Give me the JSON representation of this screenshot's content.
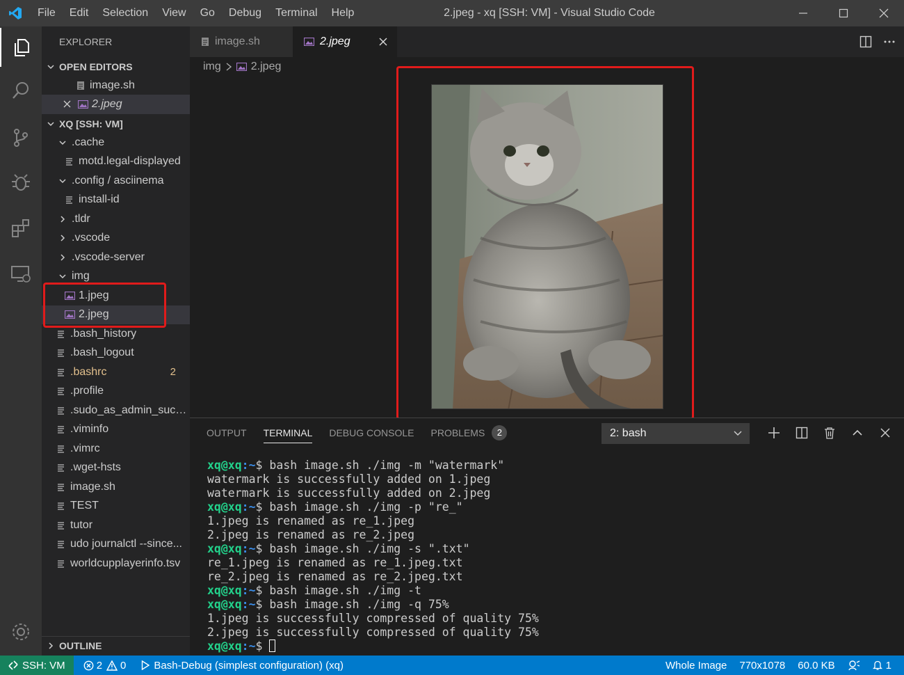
{
  "window": {
    "title": "2.jpeg - xq [SSH: VM] - Visual Studio Code",
    "menu": [
      "File",
      "Edit",
      "Selection",
      "View",
      "Go",
      "Debug",
      "Terminal",
      "Help"
    ]
  },
  "explorer": {
    "title": "EXPLORER",
    "open_editors_label": "OPEN EDITORS",
    "open_editors": [
      {
        "name": "image.sh"
      },
      {
        "name": "2.jpeg"
      }
    ],
    "workspace_label": "XQ [SSH: VM]",
    "tree": [
      {
        "label": ".cache",
        "type": "folder-open"
      },
      {
        "label": "motd.legal-displayed",
        "type": "file"
      },
      {
        "label": ".config / asciinema",
        "type": "folder-open"
      },
      {
        "label": "install-id",
        "type": "file"
      },
      {
        "label": ".tldr",
        "type": "folder-closed"
      },
      {
        "label": ".vscode",
        "type": "folder-closed"
      },
      {
        "label": ".vscode-server",
        "type": "folder-closed"
      },
      {
        "label": "img",
        "type": "folder-open"
      },
      {
        "label": "1.jpeg",
        "type": "image"
      },
      {
        "label": "2.jpeg",
        "type": "image"
      },
      {
        "label": ".bash_history",
        "type": "file"
      },
      {
        "label": ".bash_logout",
        "type": "file"
      },
      {
        "label": ".bashrc",
        "type": "file",
        "badge": "2"
      },
      {
        "label": ".profile",
        "type": "file"
      },
      {
        "label": ".sudo_as_admin_succ...",
        "type": "file"
      },
      {
        "label": ".viminfo",
        "type": "file"
      },
      {
        "label": ".vimrc",
        "type": "file"
      },
      {
        "label": ".wget-hsts",
        "type": "file"
      },
      {
        "label": "image.sh",
        "type": "file"
      },
      {
        "label": "TEST",
        "type": "file"
      },
      {
        "label": "tutor",
        "type": "file"
      },
      {
        "label": "udo journalctl --since...",
        "type": "file"
      },
      {
        "label": "worldcupplayerinfo.tsv",
        "type": "file"
      }
    ],
    "outline_label": "OUTLINE"
  },
  "tabs": [
    {
      "label": "image.sh",
      "active": false
    },
    {
      "label": "2.jpeg",
      "active": true
    }
  ],
  "breadcrumb": [
    "img",
    "2.jpeg"
  ],
  "panel": {
    "tabs": [
      "OUTPUT",
      "TERMINAL",
      "DEBUG CONSOLE",
      "PROBLEMS"
    ],
    "problems_count": "2",
    "terminal_select": "2: bash",
    "prompt_user": "xq@xq",
    "prompt_path": ":~",
    "prompt_end": "$ ",
    "lines": [
      {
        "prompt": true,
        "text": "bash image.sh ./img -m \"watermark\""
      },
      {
        "prompt": false,
        "text": "watermark is successfully added on 1.jpeg"
      },
      {
        "prompt": false,
        "text": "watermark is successfully added on 2.jpeg"
      },
      {
        "prompt": true,
        "text": "bash image.sh ./img -p \"re_\""
      },
      {
        "prompt": false,
        "text": "1.jpeg is renamed as re_1.jpeg"
      },
      {
        "prompt": false,
        "text": "2.jpeg is renamed as re_2.jpeg"
      },
      {
        "prompt": true,
        "text": "bash image.sh ./img -s \".txt\""
      },
      {
        "prompt": false,
        "text": "re_1.jpeg is renamed as re_1.jpeg.txt"
      },
      {
        "prompt": false,
        "text": "re_2.jpeg is renamed as re_2.jpeg.txt"
      },
      {
        "prompt": true,
        "text": "bash image.sh ./img -t"
      },
      {
        "prompt": true,
        "text": "bash image.sh ./img -q 75%"
      },
      {
        "prompt": false,
        "text": "1.jpeg is successfully compressed of quality 75%"
      },
      {
        "prompt": false,
        "text": "2.jpeg is successfully compressed of quality 75%"
      },
      {
        "prompt": true,
        "text": ""
      }
    ]
  },
  "statusbar": {
    "remote": "SSH: VM",
    "errors": "2",
    "warnings": "0",
    "debug": "Bash-Debug (simplest configuration) (xq)",
    "image_mode": "Whole Image",
    "dimensions": "770x1078",
    "size": "60.0 KB",
    "notifications": "1"
  },
  "colors": {
    "highlight_box": "#e01b1b",
    "statusbar": "#007acc",
    "remote": "#16825d",
    "prompt_user": "#23d18b",
    "prompt_path": "#3b8eea"
  }
}
